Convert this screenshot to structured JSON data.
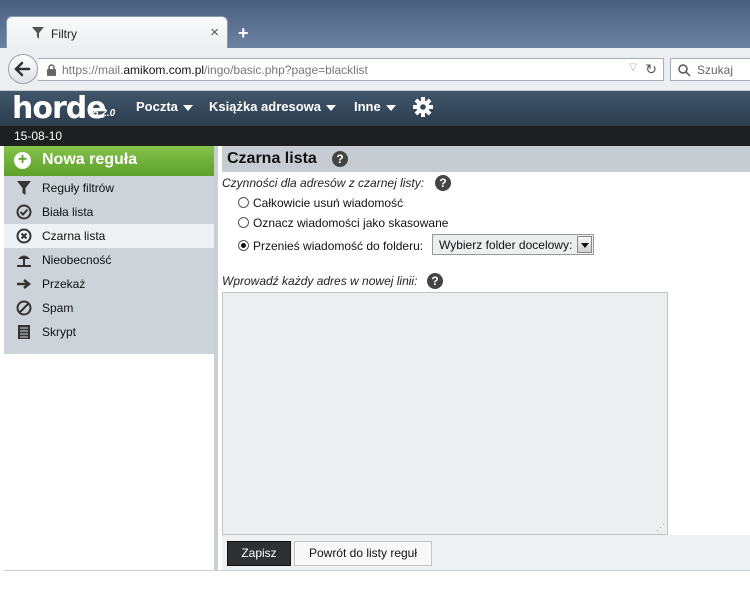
{
  "browser": {
    "tab_title": "Filtry",
    "tab_close": "×",
    "new_tab": "+",
    "url_prefix": "https://mail.",
    "url_host": "amikom.com.pl",
    "url_path": "/ingo/basic.php?page=blacklist",
    "search_placeholder": "Szukaj"
  },
  "horde": {
    "logo": "horde",
    "version": "5.2.0",
    "menu": [
      "Poczta",
      "Książka adresowa",
      "Inne"
    ],
    "date": "15-08-10"
  },
  "sidebar": {
    "new_rule": "Nowa reguła",
    "items": [
      {
        "label": "Reguły filtrów",
        "icon": "filter-icon",
        "active": false
      },
      {
        "label": "Biała lista",
        "icon": "check-circle-icon",
        "active": false
      },
      {
        "label": "Czarna lista",
        "icon": "x-circle-icon",
        "active": true
      },
      {
        "label": "Nieobecność",
        "icon": "vacation-icon",
        "active": false
      },
      {
        "label": "Przekaż",
        "icon": "forward-arrow-icon",
        "active": false
      },
      {
        "label": "Spam",
        "icon": "no-entry-icon",
        "active": false
      },
      {
        "label": "Skrypt",
        "icon": "script-icon",
        "active": false
      }
    ]
  },
  "main": {
    "title": "Czarna lista",
    "actions_label": "Czynności dla adresów z czarnej listy:",
    "options": [
      {
        "label": "Całkowicie usuń wiadomość",
        "checked": false
      },
      {
        "label": "Oznacz wiadomości jako skasowane",
        "checked": false
      },
      {
        "label": "Przenieś wiadomość do folderu:",
        "checked": true
      }
    ],
    "folder_select": "Wybierz folder docelowy:",
    "address_label": "Wprowadź każdy adres w nowej linii:",
    "address_value": "",
    "save_button": "Zapisz",
    "back_button": "Powrót do listy reguł"
  },
  "colors": {
    "horde_bar": "#34475a",
    "new_rule_green": "#6fb23a",
    "sidebar_bg": "#ccd4d9"
  }
}
